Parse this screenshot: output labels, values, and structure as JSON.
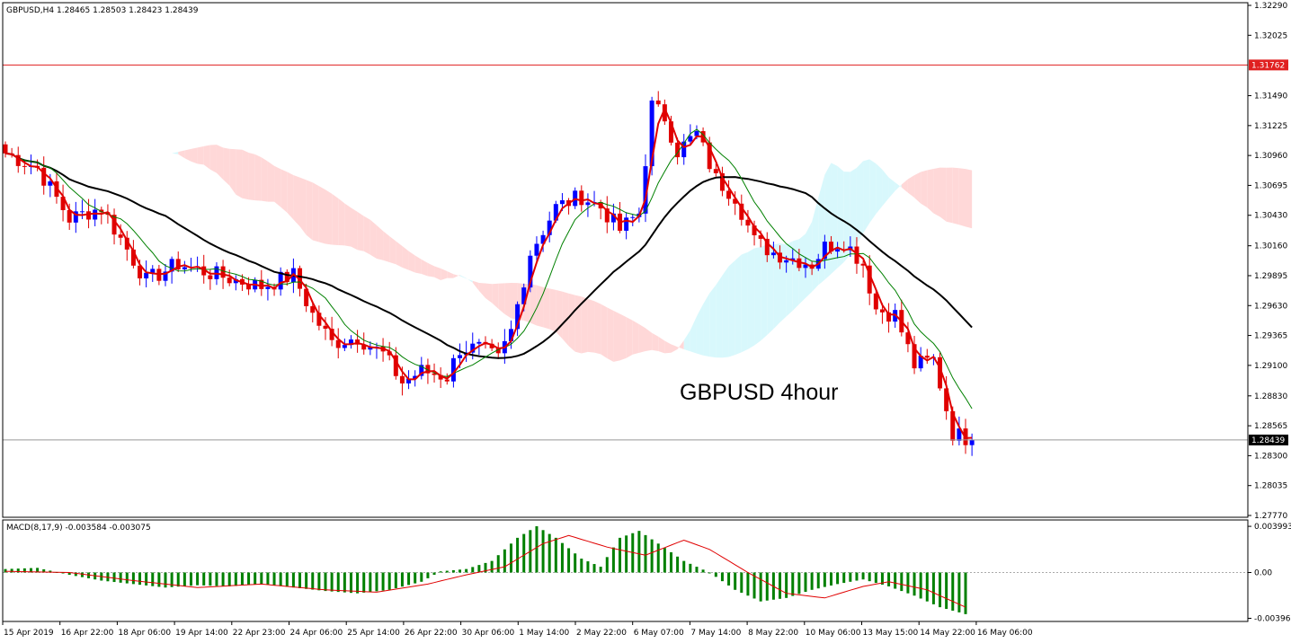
{
  "chart_data": {
    "type": "candlestick",
    "symbol_header": "GBPUSD,H4  1.28465 1.28503 1.28423 1.28439",
    "annotation": "GBPUSD 4hour",
    "price_axis": {
      "ylim": [
        1.2777,
        1.3229
      ],
      "ticks": [
        "1.32290",
        "1.32025",
        "1.31490",
        "1.31225",
        "1.30960",
        "1.30695",
        "1.30430",
        "1.30160",
        "1.29895",
        "1.29630",
        "1.29365",
        "1.29100",
        "1.28830",
        "1.28565",
        "1.28300",
        "1.28035",
        "1.27770"
      ]
    },
    "resistance_level": {
      "value": "1.31762",
      "price": 1.31762,
      "color": "#e02020"
    },
    "current_price": {
      "value": "1.28439",
      "price": 1.28439
    },
    "time_axis": [
      "15 Apr 2019",
      "16 Apr 22:00",
      "18 Apr 06:00",
      "19 Apr 14:00",
      "22 Apr 23:00",
      "24 Apr 06:00",
      "25 Apr 14:00",
      "26 Apr 22:00",
      "30 Apr 06:00",
      "1 May 14:00",
      "2 May 22:00",
      "6 May 07:00",
      "7 May 14:00",
      "8 May 22:00",
      "10 May 06:00",
      "13 May 15:00",
      "14 May 22:00",
      "16 May 06:00"
    ],
    "close_path": [
      [
        0,
        1.3098
      ],
      [
        5,
        1.3085
      ],
      [
        10,
        1.304
      ],
      [
        15,
        1.305
      ],
      [
        22,
        1.2985
      ],
      [
        27,
        1.3
      ],
      [
        33,
        1.299
      ],
      [
        40,
        1.298
      ],
      [
        45,
        1.299
      ],
      [
        48,
        1.2955
      ],
      [
        51,
        1.293
      ],
      [
        55,
        1.2935
      ],
      [
        59,
        1.292
      ],
      [
        62,
        1.2895
      ],
      [
        65,
        1.2905
      ],
      [
        69,
        1.29
      ],
      [
        71,
        1.2925
      ],
      [
        74,
        1.2925
      ],
      [
        77,
        1.2915
      ],
      [
        79,
        1.294
      ],
      [
        82,
        1.301
      ],
      [
        86,
        1.305
      ],
      [
        90,
        1.306
      ],
      [
        93,
        1.305
      ],
      [
        96,
        1.303
      ],
      [
        99,
        1.3045
      ],
      [
        101,
        1.314
      ],
      [
        103,
        1.313
      ],
      [
        105,
        1.31
      ],
      [
        108,
        1.3115
      ],
      [
        111,
        1.3075
      ],
      [
        114,
        1.306
      ],
      [
        117,
        1.302
      ],
      [
        120,
        1.301
      ],
      [
        123,
        1.3005
      ],
      [
        126,
        1.3
      ],
      [
        128,
        1.3015
      ],
      [
        131,
        1.302
      ],
      [
        134,
        1.3
      ],
      [
        136,
        1.296
      ],
      [
        139,
        1.2955
      ],
      [
        142,
        1.291
      ],
      [
        145,
        1.2915
      ],
      [
        148,
        1.285
      ],
      [
        151,
        1.2844
      ]
    ],
    "legend_text": "MACD(8,17,9) -0.003584 -0.003075",
    "macd_axis": {
      "ticks": [
        "0.003993",
        "0.00",
        "-0.003962"
      ],
      "ylim": [
        -0.004,
        0.004
      ]
    },
    "macd_hist": [
      [
        0,
        0.0003
      ],
      [
        5,
        0.0004
      ],
      [
        10,
        -0.0002
      ],
      [
        15,
        -0.0007
      ],
      [
        20,
        -0.001
      ],
      [
        25,
        -0.0013
      ],
      [
        30,
        -0.0011
      ],
      [
        35,
        -0.0012
      ],
      [
        40,
        -0.001
      ],
      [
        45,
        -0.0013
      ],
      [
        50,
        -0.0016
      ],
      [
        55,
        -0.0018
      ],
      [
        60,
        -0.0015
      ],
      [
        65,
        -0.0008
      ],
      [
        68,
        0.0001
      ],
      [
        72,
        0.0003
      ],
      [
        76,
        0.001
      ],
      [
        80,
        0.003
      ],
      [
        83,
        0.004
      ],
      [
        86,
        0.003
      ],
      [
        90,
        0.0012
      ],
      [
        93,
        0.0005
      ],
      [
        96,
        0.003
      ],
      [
        99,
        0.0036
      ],
      [
        102,
        0.0025
      ],
      [
        106,
        0.001
      ],
      [
        110,
        0.0
      ],
      [
        114,
        -0.0015
      ],
      [
        118,
        -0.0025
      ],
      [
        122,
        -0.0022
      ],
      [
        126,
        -0.0015
      ],
      [
        130,
        -0.001
      ],
      [
        134,
        -0.0006
      ],
      [
        138,
        -0.0012
      ],
      [
        142,
        -0.002
      ],
      [
        146,
        -0.003
      ],
      [
        150,
        -0.0036
      ]
    ],
    "macd_signal": [
      [
        0,
        0.0001
      ],
      [
        10,
        0.0
      ],
      [
        20,
        -0.0007
      ],
      [
        30,
        -0.0013
      ],
      [
        40,
        -0.001
      ],
      [
        50,
        -0.0015
      ],
      [
        58,
        -0.0017
      ],
      [
        66,
        -0.001
      ],
      [
        72,
        -0.0002
      ],
      [
        78,
        0.0005
      ],
      [
        84,
        0.0025
      ],
      [
        88,
        0.0032
      ],
      [
        94,
        0.0022
      ],
      [
        100,
        0.0015
      ],
      [
        106,
        0.0028
      ],
      [
        110,
        0.002
      ],
      [
        116,
        0.0
      ],
      [
        122,
        -0.0018
      ],
      [
        128,
        -0.0022
      ],
      [
        134,
        -0.0012
      ],
      [
        138,
        -0.0008
      ],
      [
        144,
        -0.0015
      ],
      [
        150,
        -0.003
      ]
    ],
    "colors": {
      "bull": "#0000ff",
      "bear": "#e00000",
      "ma_fast": "#e00000",
      "ma_mid": "#008000",
      "ma_slow": "#000000",
      "cloud_bear": "#ffd8d8",
      "cloud_bull": "#d8f8fc",
      "macd_hist": "#008000",
      "macd_signal": "#e00000"
    }
  }
}
